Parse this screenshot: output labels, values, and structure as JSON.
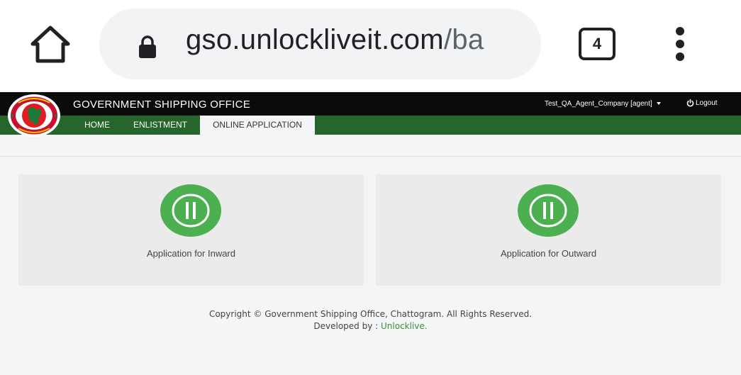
{
  "browser": {
    "url_host": "gso.unlockliveit.com",
    "url_path": "/ba",
    "tab_count": "4",
    "icons": {
      "home": "home-icon",
      "lock": "lock-icon",
      "tabs": "tabs-icon",
      "menu": "more-vert-icon"
    }
  },
  "header": {
    "title": "GOVERNMENT SHIPPING OFFICE",
    "user": "Test_QA_Agent_Company [agent]",
    "logout_label": "Logout",
    "nav": {
      "home": "HOME",
      "enlistment": "ENLISTMENT",
      "online_application": "ONLINE APPLICATION"
    }
  },
  "cards": {
    "inward": {
      "label": "Application for Inward"
    },
    "outward": {
      "label": "Application for Outward"
    }
  },
  "footer": {
    "copyright": "Copyright © Government Shipping Office, Chattogram. All Rights Reserved.",
    "developed_prefix": "Developed by :",
    "developer": "Unlocklive."
  },
  "colors": {
    "topbar": "#0b0b0b",
    "navbar": "#26652c",
    "icon_green": "#4caf50",
    "link_green": "#3a8f3e"
  }
}
